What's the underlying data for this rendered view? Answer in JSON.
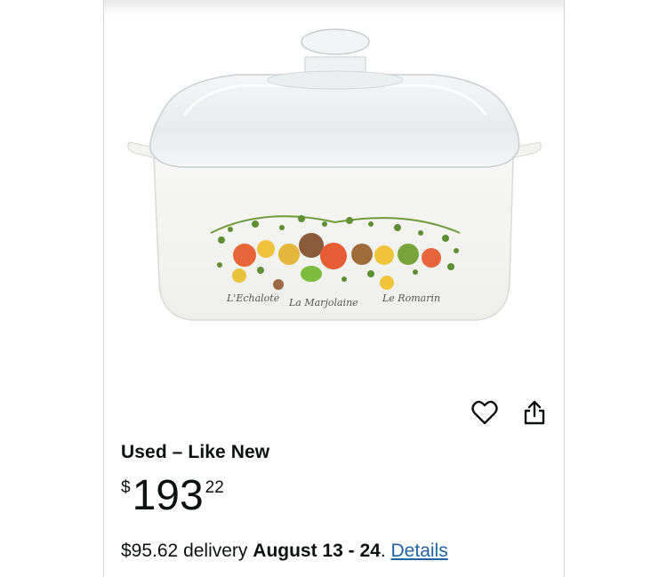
{
  "product": {
    "image_alt": "Corning Ware Spice of Life square casserole with glass lid",
    "decor_labels": [
      "L'Echalote",
      "La Marjolaine",
      "Le Romarin"
    ]
  },
  "actions": {
    "wishlist_icon": "heart-outline-icon",
    "share_icon": "share-icon"
  },
  "offer": {
    "condition": "Used – Like New",
    "price_symbol": "$",
    "price_whole": "193",
    "price_fraction": "22",
    "delivery_cost": "$95.62 delivery",
    "delivery_date": "August 13 - 24",
    "delivery_period": ".",
    "details_link": "Details"
  },
  "colors": {
    "text": "#0f1111",
    "link": "#2162a1",
    "border": "#d5d9d9"
  }
}
